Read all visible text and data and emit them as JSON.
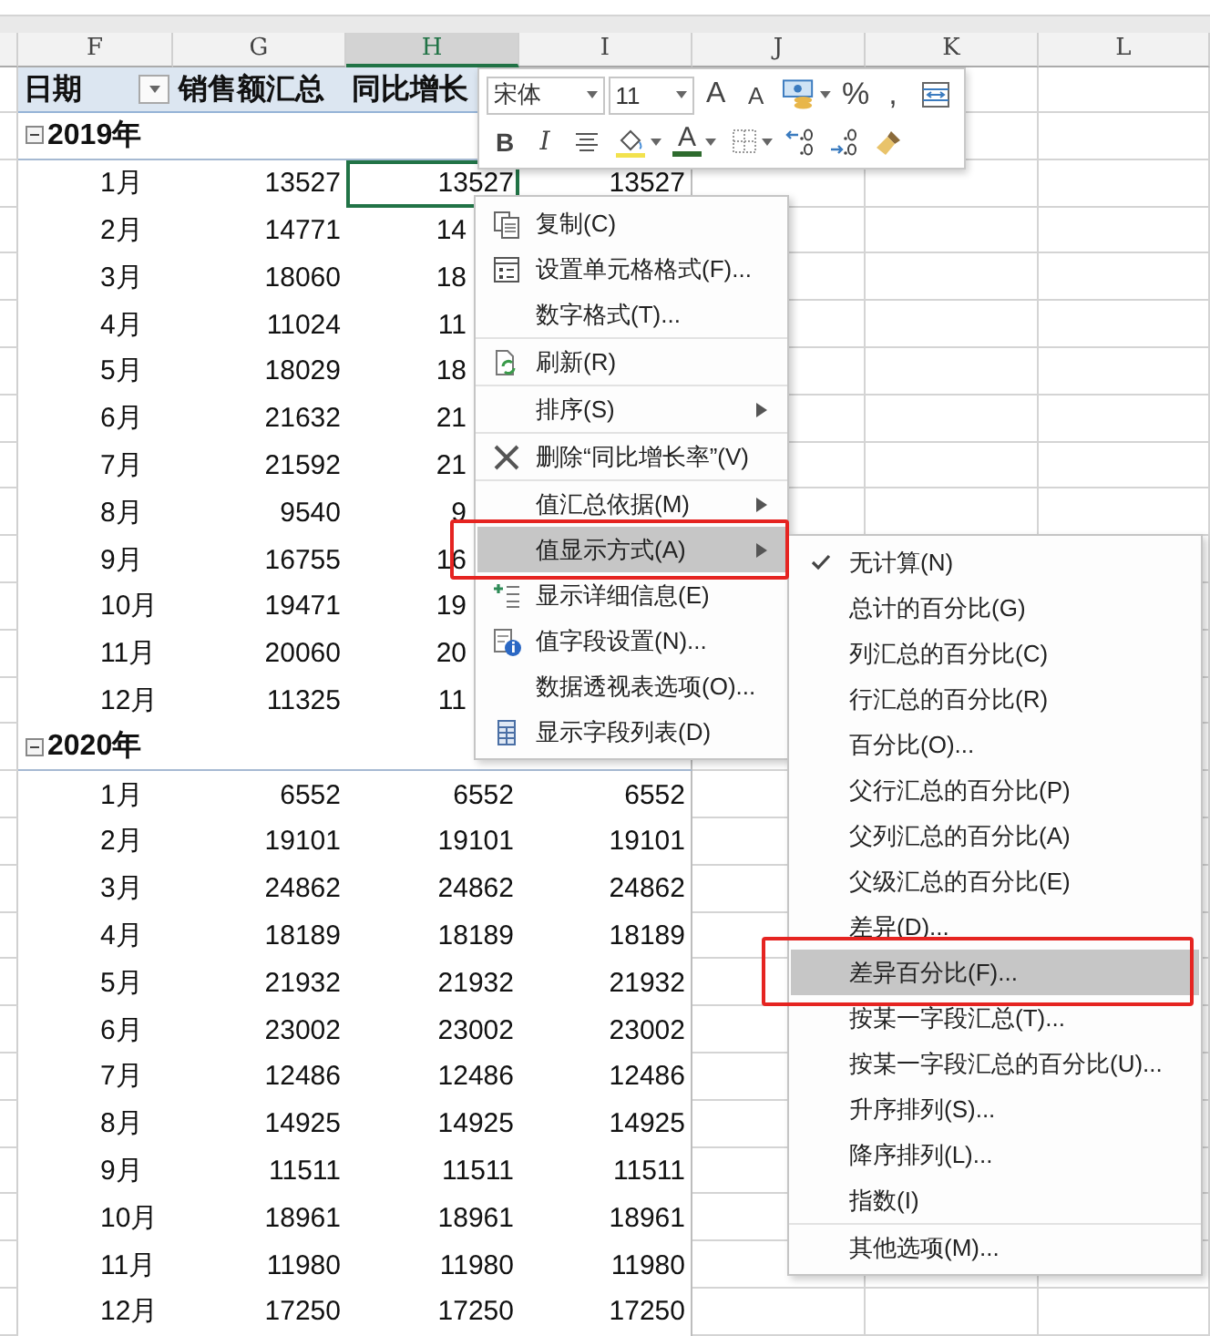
{
  "columns": [
    {
      "label": "F",
      "selected": false
    },
    {
      "label": "G",
      "selected": false
    },
    {
      "label": "H",
      "selected": true
    },
    {
      "label": "I",
      "selected": false
    },
    {
      "label": "J",
      "selected": false
    },
    {
      "label": "K",
      "selected": false
    },
    {
      "label": "L",
      "selected": false
    }
  ],
  "pivot": {
    "headers": [
      {
        "text": "日期",
        "filter": true
      },
      {
        "text": "销售额汇总",
        "filter": false
      },
      {
        "text": "同比增长",
        "filter": false
      }
    ],
    "groups": [
      {
        "year": "2019年",
        "expanded": true,
        "rows": [
          {
            "month": "1月",
            "values": [
              "13527",
              "13527",
              "13527"
            ],
            "selected": true,
            "cut": false
          },
          {
            "month": "2月",
            "values": [
              "14771",
              "14"
            ],
            "selected": false,
            "cut": true
          },
          {
            "month": "3月",
            "values": [
              "18060",
              "18"
            ],
            "selected": false,
            "cut": true
          },
          {
            "month": "4月",
            "values": [
              "11024",
              "11"
            ],
            "selected": false,
            "cut": true
          },
          {
            "month": "5月",
            "values": [
              "18029",
              "18"
            ],
            "selected": false,
            "cut": true
          },
          {
            "month": "6月",
            "values": [
              "21632",
              "21"
            ],
            "selected": false,
            "cut": true
          },
          {
            "month": "7月",
            "values": [
              "21592",
              "21"
            ],
            "selected": false,
            "cut": true
          },
          {
            "month": "8月",
            "values": [
              "9540",
              "9"
            ],
            "selected": false,
            "cut": true
          },
          {
            "month": "9月",
            "values": [
              "16755",
              "16"
            ],
            "selected": false,
            "cut": true
          },
          {
            "month": "10月",
            "values": [
              "19471",
              "19"
            ],
            "selected": false,
            "cut": true
          },
          {
            "month": "11月",
            "values": [
              "20060",
              "20"
            ],
            "selected": false,
            "cut": true
          },
          {
            "month": "12月",
            "values": [
              "11325",
              "11"
            ],
            "selected": false,
            "cut": true
          }
        ]
      },
      {
        "year": "2020年",
        "expanded": true,
        "rows": [
          {
            "month": "1月",
            "values": [
              "6552",
              "6552",
              "6552"
            ],
            "selected": false,
            "cut": false
          },
          {
            "month": "2月",
            "values": [
              "19101",
              "19101",
              "19101"
            ],
            "selected": false,
            "cut": false
          },
          {
            "month": "3月",
            "values": [
              "24862",
              "24862",
              "24862"
            ],
            "selected": false,
            "cut": false
          },
          {
            "month": "4月",
            "values": [
              "18189",
              "18189",
              "18189"
            ],
            "selected": false,
            "cut": false
          },
          {
            "month": "5月",
            "values": [
              "21932",
              "21932",
              "21932"
            ],
            "selected": false,
            "cut": false
          },
          {
            "month": "6月",
            "values": [
              "23002",
              "23002",
              "23002"
            ],
            "selected": false,
            "cut": false
          },
          {
            "month": "7月",
            "values": [
              "12486",
              "12486",
              "12486"
            ],
            "selected": false,
            "cut": false
          },
          {
            "month": "8月",
            "values": [
              "14925",
              "14925",
              "14925"
            ],
            "selected": false,
            "cut": false
          },
          {
            "month": "9月",
            "values": [
              "11511",
              "11511",
              "11511"
            ],
            "selected": false,
            "cut": false
          },
          {
            "month": "10月",
            "values": [
              "18961",
              "18961",
              "18961"
            ],
            "selected": false,
            "cut": false
          },
          {
            "month": "11月",
            "values": [
              "11980",
              "11980",
              "11980"
            ],
            "selected": false,
            "cut": false
          },
          {
            "month": "12月",
            "values": [
              "17250",
              "17250",
              "17250"
            ],
            "selected": false,
            "cut": false
          }
        ]
      }
    ]
  },
  "mini_toolbar": {
    "font": "宋体",
    "size": "11",
    "row_1": [
      {
        "kind": "grow",
        "label": "A"
      },
      {
        "kind": "shrink",
        "label": "A"
      },
      {
        "kind": "accounting"
      },
      {
        "kind": "text",
        "label": "%"
      },
      {
        "kind": "text",
        "label": ","
      },
      {
        "kind": "wrap"
      }
    ],
    "row_2": [
      {
        "kind": "bold",
        "label": "B"
      },
      {
        "kind": "italic",
        "label": "I"
      },
      {
        "kind": "center"
      },
      {
        "kind": "fill"
      },
      {
        "kind": "fontcolor",
        "label": "A"
      },
      {
        "kind": "borders"
      },
      {
        "kind": "incdec"
      },
      {
        "kind": "decdec"
      },
      {
        "kind": "painter"
      }
    ]
  },
  "context_menu": {
    "groups": [
      [
        {
          "label": "复制(C)",
          "kind": "copy",
          "submenu": false,
          "selected": false,
          "framed": false
        },
        {
          "label": "设置单元格格式(F)...",
          "kind": "format",
          "submenu": false,
          "selected": false,
          "framed": false
        },
        {
          "label": "数字格式(T)...",
          "kind": "plain",
          "submenu": false,
          "selected": false,
          "framed": false
        }
      ],
      [
        {
          "label": "刷新(R)",
          "kind": "refresh",
          "submenu": false,
          "selected": false,
          "framed": false
        }
      ],
      [
        {
          "label": "排序(S)",
          "kind": "plain",
          "submenu": true,
          "selected": false,
          "framed": false
        }
      ],
      [
        {
          "label": "删除“同比增长率”(V)",
          "kind": "delete",
          "submenu": false,
          "selected": false,
          "framed": false
        }
      ],
      [
        {
          "label": "值汇总依据(M)",
          "kind": "plain",
          "submenu": true,
          "selected": false,
          "framed": false
        },
        {
          "label": "值显示方式(A)",
          "kind": "plain",
          "submenu": true,
          "selected": true,
          "framed": true
        },
        {
          "label": "显示详细信息(E)",
          "kind": "details",
          "submenu": false,
          "selected": false,
          "framed": false
        },
        {
          "label": "值字段设置(N)...",
          "kind": "settings",
          "submenu": false,
          "selected": false,
          "framed": false
        },
        {
          "label": "数据透视表选项(O)...",
          "kind": "plain",
          "submenu": false,
          "selected": false,
          "framed": false
        },
        {
          "label": "显示字段列表(D)",
          "kind": "fieldlist",
          "submenu": false,
          "selected": false,
          "framed": false
        }
      ]
    ]
  },
  "submenu": {
    "groups": [
      [
        {
          "label": "无计算(N)",
          "checked": true,
          "selected": false,
          "framed": false
        },
        {
          "label": "总计的百分比(G)",
          "checked": false,
          "selected": false,
          "framed": false
        },
        {
          "label": "列汇总的百分比(C)",
          "checked": false,
          "selected": false,
          "framed": false
        },
        {
          "label": "行汇总的百分比(R)",
          "checked": false,
          "selected": false,
          "framed": false
        },
        {
          "label": "百分比(O)...",
          "checked": false,
          "selected": false,
          "framed": false
        },
        {
          "label": "父行汇总的百分比(P)",
          "checked": false,
          "selected": false,
          "framed": false
        },
        {
          "label": "父列汇总的百分比(A)",
          "checked": false,
          "selected": false,
          "framed": false
        },
        {
          "label": "父级汇总的百分比(E)",
          "checked": false,
          "selected": false,
          "framed": false
        },
        {
          "label": "差异(D)...",
          "checked": false,
          "selected": false,
          "framed": false
        },
        {
          "label": "差异百分比(F)...",
          "checked": false,
          "selected": true,
          "framed": true
        },
        {
          "label": "按某一字段汇总(T)...",
          "checked": false,
          "selected": false,
          "framed": false
        },
        {
          "label": "按某一字段汇总的百分比(U)...",
          "checked": false,
          "selected": false,
          "framed": false
        },
        {
          "label": "升序排列(S)...",
          "checked": false,
          "selected": false,
          "framed": false
        },
        {
          "label": "降序排列(L)...",
          "checked": false,
          "selected": false,
          "framed": false
        },
        {
          "label": "指数(I)",
          "checked": false,
          "selected": false,
          "framed": false
        }
      ],
      [
        {
          "label": "其他选项(M)...",
          "checked": false,
          "selected": false,
          "framed": false
        }
      ]
    ]
  }
}
